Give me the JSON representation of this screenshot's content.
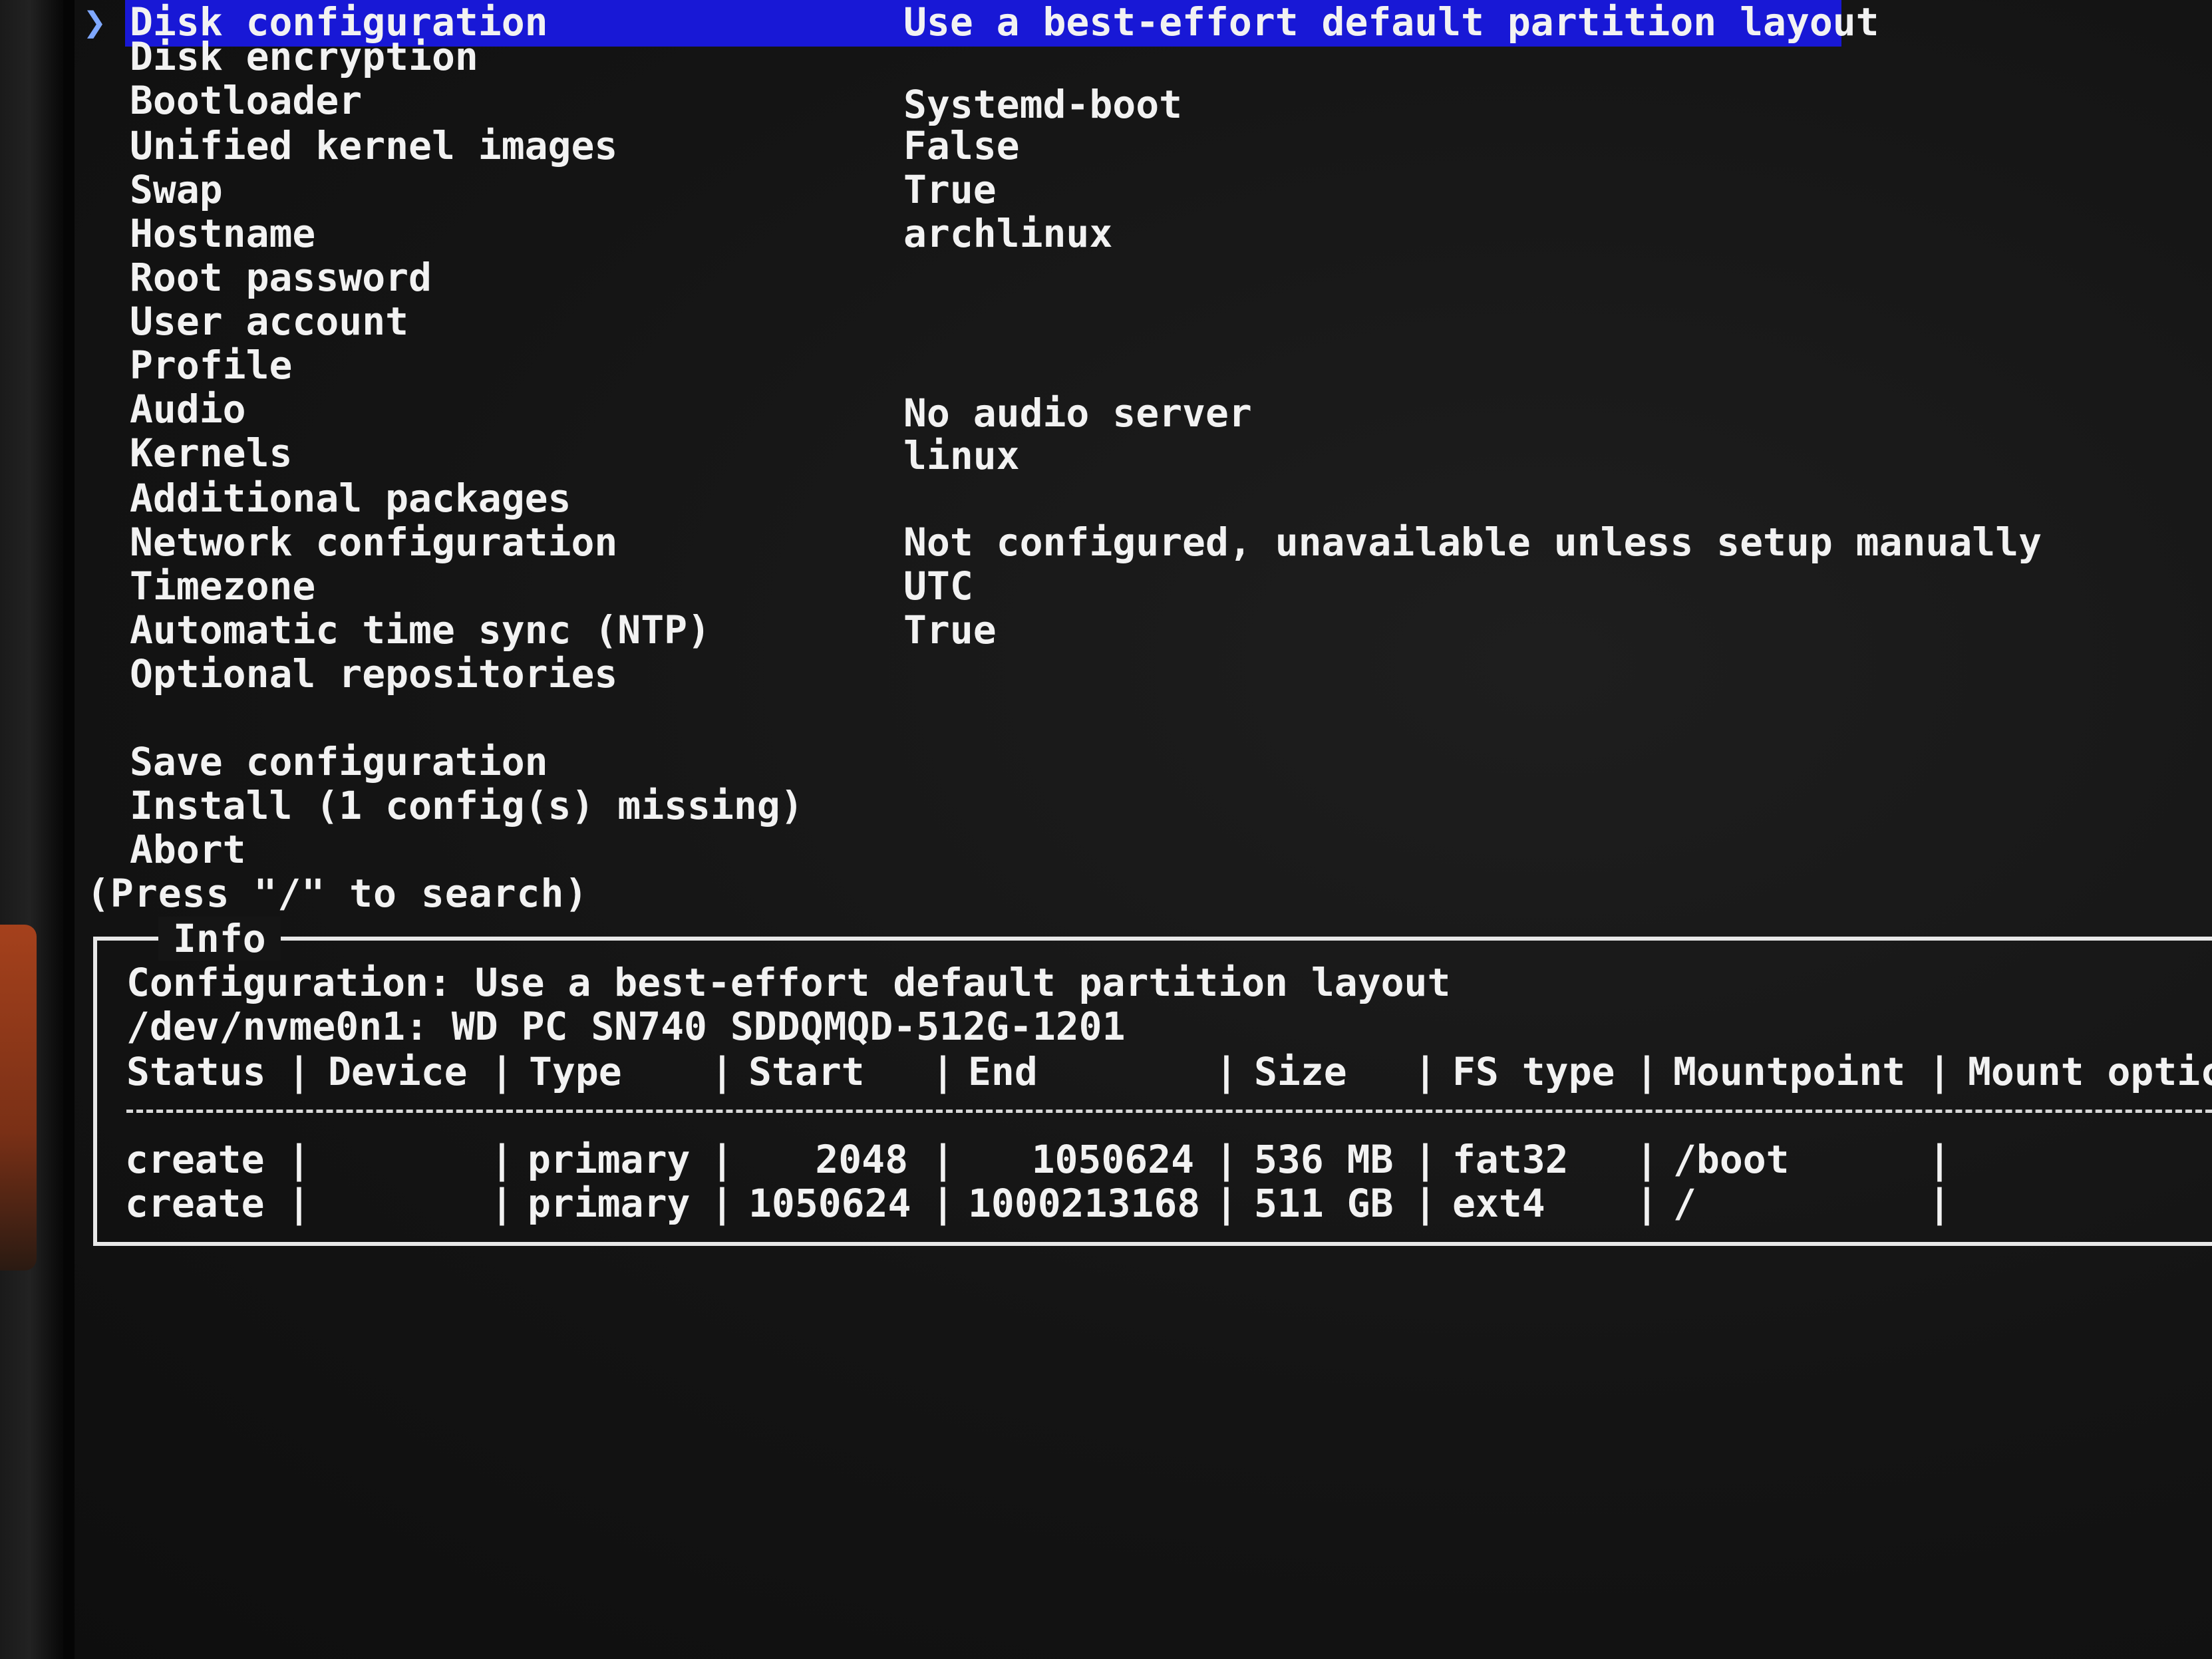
{
  "menu": {
    "items": [
      {
        "label": "Disk configuration",
        "value": "Use a best-effort default partition layout",
        "selected": true
      },
      {
        "label": "Disk encryption",
        "value": ""
      },
      {
        "label": "Bootloader",
        "value": "Systemd-boot"
      },
      {
        "label": "Unified kernel images",
        "value": "False"
      },
      {
        "label": "Swap",
        "value": "True"
      },
      {
        "label": "Hostname",
        "value": "archlinux"
      },
      {
        "label": "Root password",
        "value": ""
      },
      {
        "label": "User account",
        "value": ""
      },
      {
        "label": "Profile",
        "value": ""
      },
      {
        "label": "Audio",
        "value": "No audio server"
      },
      {
        "label": "Kernels",
        "value": "linux"
      },
      {
        "label": "Additional packages",
        "value": ""
      },
      {
        "label": "Network configuration",
        "value": "Not configured, unavailable unless setup manually"
      },
      {
        "label": "Timezone",
        "value": "UTC"
      },
      {
        "label": "Automatic time sync (NTP)",
        "value": "True"
      },
      {
        "label": "Optional repositories",
        "value": ""
      }
    ],
    "actions": [
      {
        "label": "Save configuration"
      },
      {
        "label": "Install (1 config(s) missing)"
      },
      {
        "label": "Abort"
      }
    ],
    "cursor_glyph": "❯",
    "search_hint": "(Press \"/\" to search)"
  },
  "info": {
    "title": "Info",
    "configuration_line": "Configuration: Use a best-effort default partition layout",
    "device_line": "/dev/nvme0n1: WD PC SN740 SDDQMQD-512G-1201",
    "table": {
      "separator": "|",
      "columns": [
        "Status",
        "Device",
        "Type",
        "Start",
        "End",
        "Size",
        "FS type",
        "Mountpoint",
        "Mount optic"
      ],
      "rows": [
        [
          "create",
          "",
          "primary",
          "2048",
          "1050624",
          "536 MB",
          "fat32",
          "/boot",
          ""
        ],
        [
          "create",
          "",
          "primary",
          "1050624",
          "1000213168",
          "511 GB",
          "ext4",
          "/",
          ""
        ]
      ]
    }
  },
  "colors": {
    "background": "#151515",
    "text": "#f2f2f2",
    "selection": "#1818d6",
    "cursor": "#7fa8ff"
  }
}
